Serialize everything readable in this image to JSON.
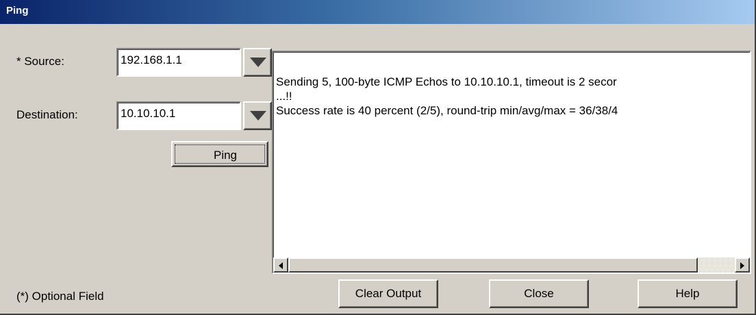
{
  "window": {
    "title": "Ping"
  },
  "form": {
    "source_label": "* Source:",
    "source_value": "192.168.1.1",
    "destination_label": "Destination:",
    "destination_value": "10.10.10.1",
    "ping_label": "Ping",
    "optional_note": "(*) Optional Field"
  },
  "output": {
    "lines": "Sending 5, 100-byte ICMP Echos to 10.10.10.1, timeout is 2 secor\n...!!\nSuccess rate is 40 percent (2/5), round-trip min/avg/max = 36/38/4"
  },
  "buttons": {
    "clear_output": "Clear Output",
    "close": "Close",
    "help": "Help"
  },
  "icons": {
    "dropdown": "triangle-down-icon",
    "scroll_left": "triangle-left-icon",
    "scroll_right": "triangle-right-icon"
  },
  "colors": {
    "title_start": "#0a246a",
    "title_end": "#a6caf0",
    "dialog_bg": "#d4d0c8"
  }
}
